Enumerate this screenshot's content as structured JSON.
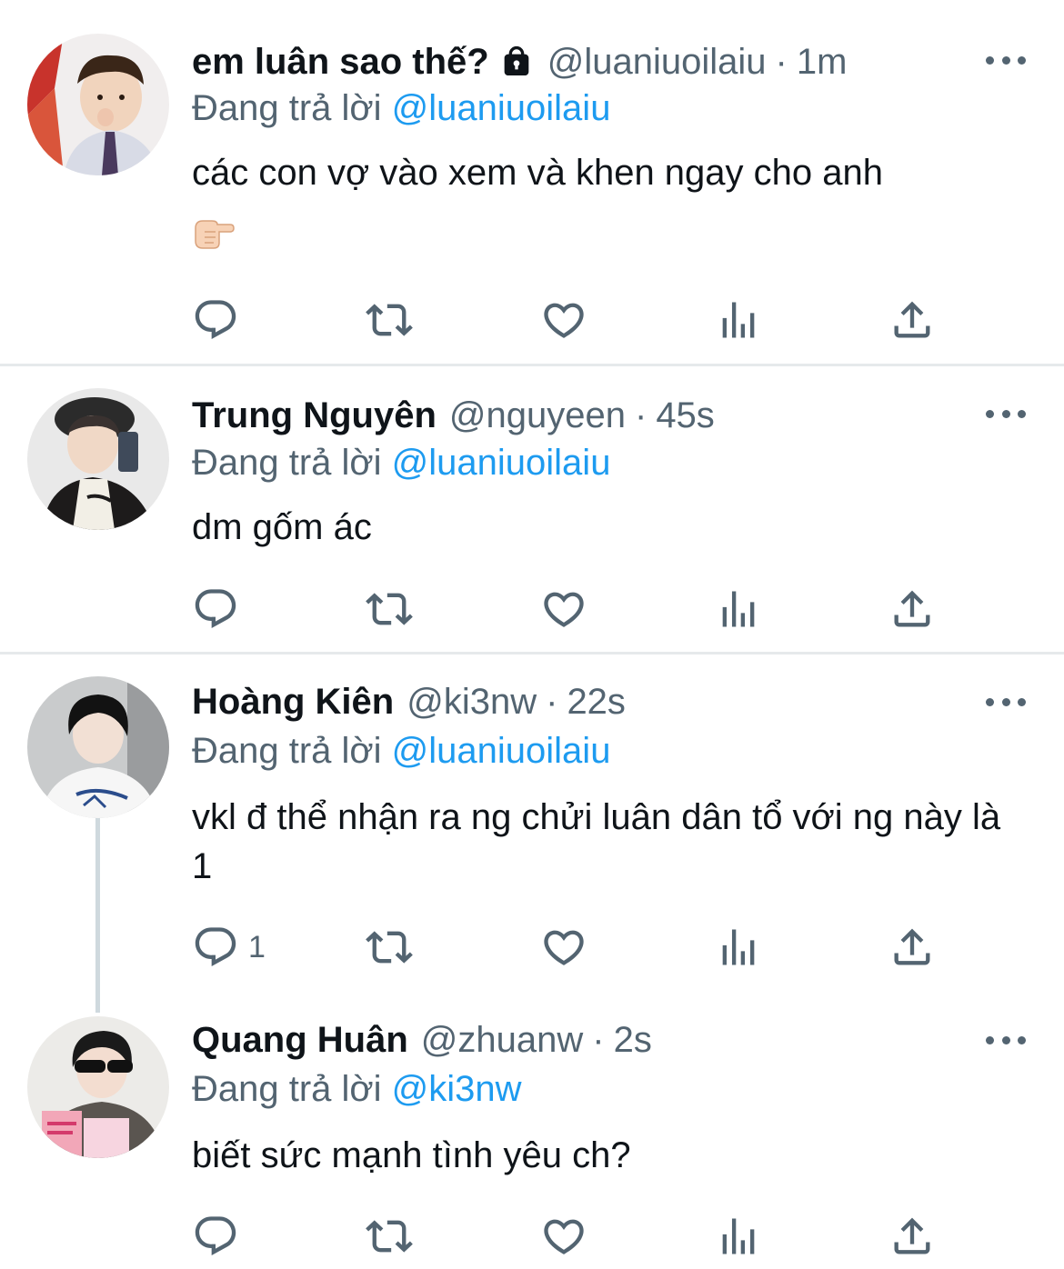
{
  "colors": {
    "link": "#1d9bf0",
    "secondary_text": "#536471",
    "primary_text": "#0f1419",
    "divider": "#e6e9eb",
    "thread_line": "#cfd9de"
  },
  "tweets": [
    {
      "name": "em luân sao thế?",
      "protected": true,
      "handle": "@luaniuoilaiu",
      "separator": "·",
      "time": "1m",
      "reply_prefix": "Đang trả lời",
      "reply_to": "@luaniuoilaiu",
      "text": "các con vợ vào xem và khen ngay cho anh",
      "emoji": "point-right-emoji",
      "reply_count": ""
    },
    {
      "name": "Trung Nguyên",
      "protected": false,
      "handle": "@nguyeen",
      "separator": "·",
      "time": "45s",
      "reply_prefix": "Đang trả lời",
      "reply_to": "@luaniuoilaiu",
      "text": "dm gốm ác",
      "reply_count": ""
    },
    {
      "name": "Hoàng Kiên",
      "protected": false,
      "handle": "@ki3nw",
      "separator": "·",
      "time": "22s",
      "reply_prefix": "Đang trả lời",
      "reply_to": "@luaniuoilaiu",
      "text": "vkl đ thể nhận ra ng chửi luân dân tổ với ng này là 1",
      "reply_count": "1"
    },
    {
      "name": "Quang Huân",
      "protected": false,
      "handle": "@zhuanw",
      "separator": "·",
      "time": "2s",
      "reply_prefix": "Đang trả lời",
      "reply_to": "@ki3nw",
      "text": "biết sức mạnh tình yêu ch?",
      "reply_count": ""
    }
  ]
}
